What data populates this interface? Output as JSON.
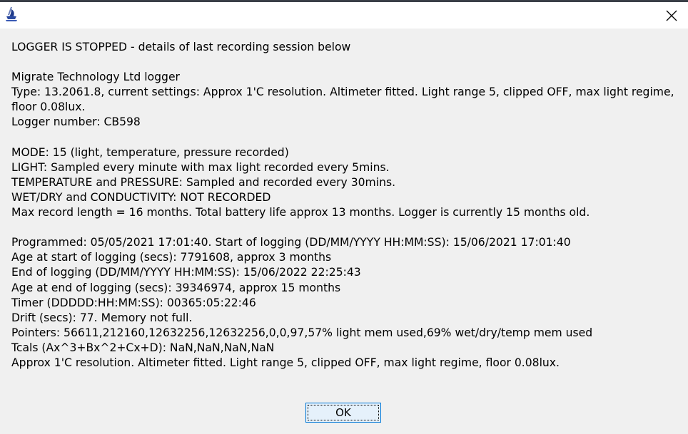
{
  "dialog": {
    "lines": [
      "LOGGER IS STOPPED - details of last recording session below",
      "",
      "Migrate Technology Ltd logger",
      "Type: 13.2061.8, current settings: Approx 1'C resolution. Altimeter fitted. Light range 5, clipped OFF, max light regime, floor 0.08lux.",
      "Logger number: CB598",
      "",
      "MODE: 15 (light, temperature, pressure recorded)",
      "LIGHT: Sampled every minute with max light recorded every 5mins.",
      "TEMPERATURE and PRESSURE: Sampled and recorded every 30mins.",
      "WET/DRY and CONDUCTIVITY: NOT RECORDED",
      "Max record length = 16 months. Total battery life approx 13 months. Logger is currently 15 months old.",
      "",
      "Programmed: 05/05/2021 17:01:40. Start of logging (DD/MM/YYYY HH:MM:SS): 15/06/2021 17:01:40",
      "Age at start of logging (secs): 7791608, approx 3 months",
      "End of logging (DD/MM/YYYY HH:MM:SS): 15/06/2022 22:25:43",
      "Age at end of logging (secs): 39346974, approx 15 months",
      "Timer (DDDDD:HH:MM:SS): 00365:05:22:46",
      "Drift (secs): 77. Memory not full.",
      "Pointers: 56611,212160,12632256,12632256,0,0,97,57% light mem used,69% wet/dry/temp mem used",
      "Tcals (Ax^3+Bx^2+Cx+D): NaN,NaN,NaN,NaN",
      "Approx 1'C resolution. Altimeter fitted. Light range 5, clipped OFF, max light regime, floor 0.08lux."
    ],
    "ok_label": "OK"
  },
  "icons": {
    "app": "app-icon",
    "close": "close-icon"
  },
  "colors": {
    "titlebar_bg": "#ffffff",
    "dialog_bg": "#f0f0f0",
    "button_border": "#0078d7",
    "button_bg": "#e5f1fb"
  }
}
